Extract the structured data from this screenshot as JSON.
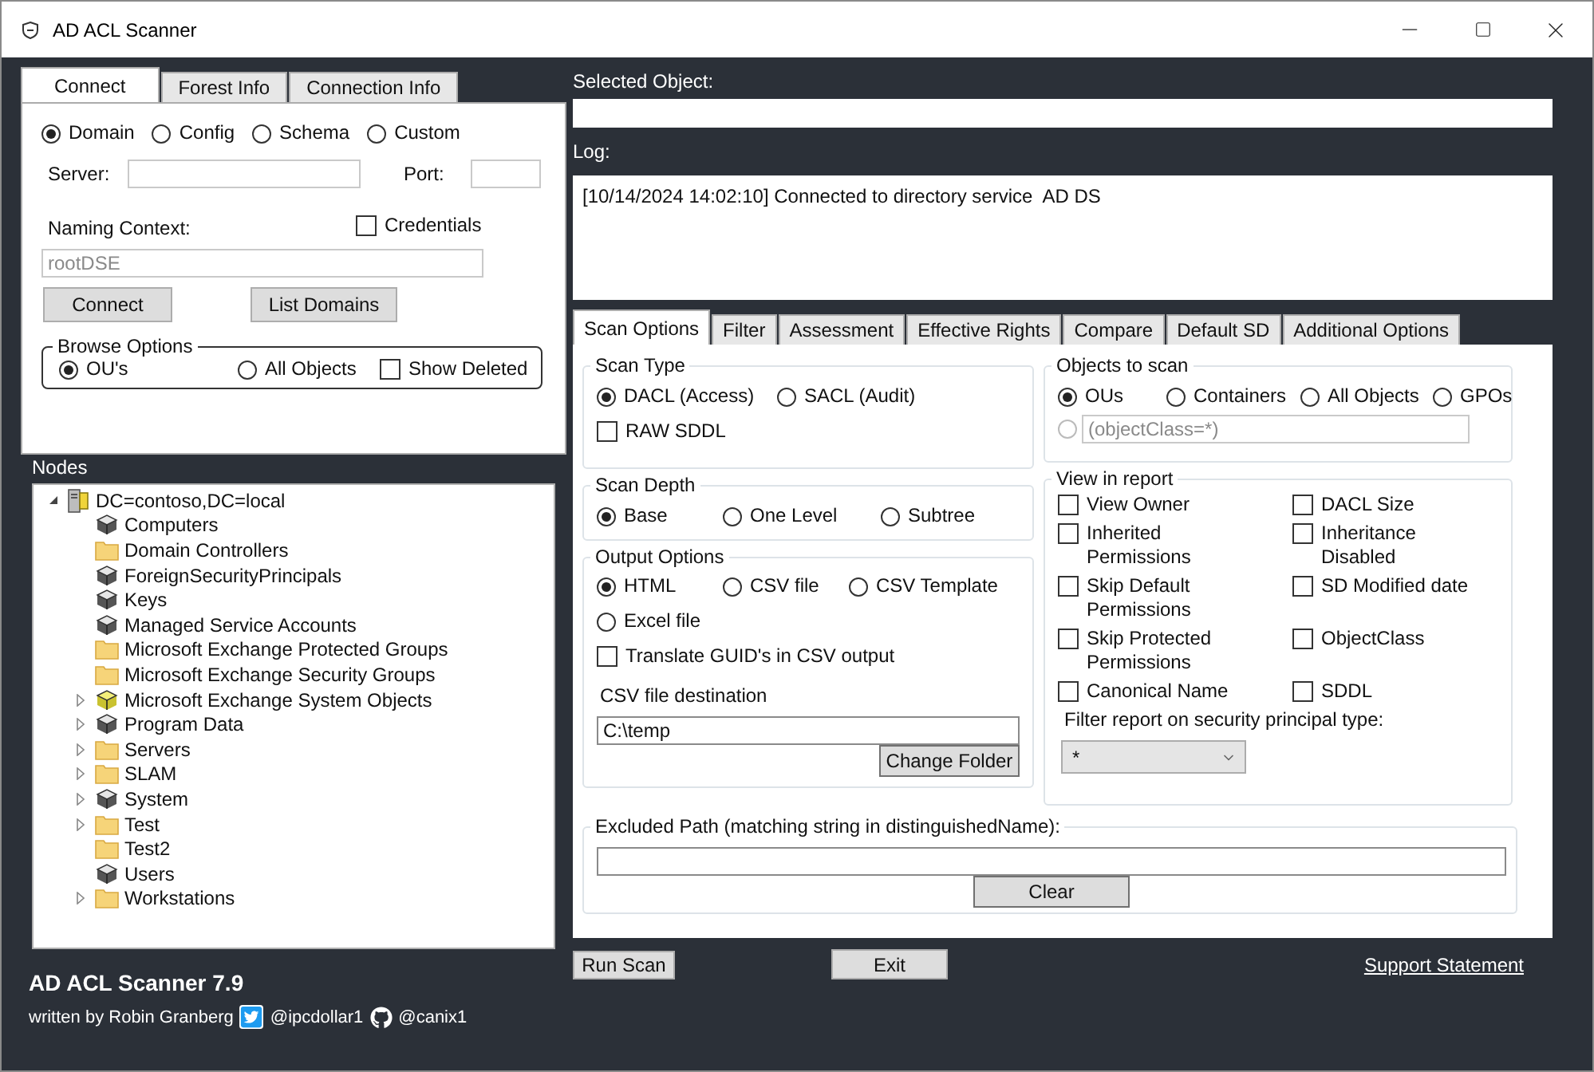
{
  "window": {
    "title": "AD ACL Scanner"
  },
  "connect_panel": {
    "tabs": [
      {
        "label": "Connect",
        "selected": true
      },
      {
        "label": "Forest Info",
        "selected": false
      },
      {
        "label": "Connection Info",
        "selected": false
      }
    ],
    "scope": [
      {
        "label": "Domain",
        "selected": true
      },
      {
        "label": "Config",
        "selected": false
      },
      {
        "label": "Schema",
        "selected": false
      },
      {
        "label": "Custom",
        "selected": false
      }
    ],
    "server_label": "Server:",
    "port_label": "Port:",
    "naming_context_label": "Naming Context:",
    "credentials": {
      "label": "Credentials",
      "checked": false
    },
    "naming_context": {
      "value": "rootDSE",
      "disabled": true
    },
    "buttons": [
      "Connect",
      "List Domains"
    ],
    "browse_options": {
      "title": "Browse Options",
      "items": [
        {
          "kind": "radio",
          "label": "OU's",
          "selected": true
        },
        {
          "kind": "radio",
          "label": "All Objects",
          "selected": false
        },
        {
          "kind": "checkbox",
          "label": "Show Deleted",
          "checked": false
        }
      ]
    }
  },
  "nodes": {
    "title": "Nodes",
    "tree": [
      {
        "label": "DC=contoso,DC=local",
        "kind": "domain",
        "has_children": true,
        "expanded": true,
        "children": [
          {
            "label": "Computers",
            "kind": "container",
            "has_children": false,
            "expanded": false
          },
          {
            "label": "Domain Controllers",
            "kind": "folder",
            "has_children": false,
            "expanded": false
          },
          {
            "label": "ForeignSecurityPrincipals",
            "kind": "container",
            "has_children": false,
            "expanded": false
          },
          {
            "label": "Keys",
            "kind": "container",
            "has_children": false,
            "expanded": false
          },
          {
            "label": "Managed Service Accounts",
            "kind": "container",
            "has_children": false,
            "expanded": false
          },
          {
            "label": "Microsoft Exchange Protected Groups",
            "kind": "folder",
            "has_children": false,
            "expanded": false
          },
          {
            "label": "Microsoft Exchange Security Groups",
            "kind": "folder",
            "has_children": false,
            "expanded": false
          },
          {
            "label": "Microsoft Exchange System Objects",
            "kind": "exchange",
            "has_children": true,
            "expanded": false
          },
          {
            "label": "Program Data",
            "kind": "container",
            "has_children": true,
            "expanded": false
          },
          {
            "label": "Servers",
            "kind": "folder",
            "has_children": true,
            "expanded": false
          },
          {
            "label": "SLAM",
            "kind": "folder",
            "has_children": true,
            "expanded": false
          },
          {
            "label": "System",
            "kind": "container",
            "has_children": true,
            "expanded": false
          },
          {
            "label": "Test",
            "kind": "folder",
            "has_children": true,
            "expanded": false
          },
          {
            "label": "Test2",
            "kind": "folder",
            "has_children": false,
            "expanded": false
          },
          {
            "label": "Users",
            "kind": "container",
            "has_children": false,
            "expanded": false
          },
          {
            "label": "Workstations",
            "kind": "folder",
            "has_children": true,
            "expanded": false
          }
        ]
      }
    ]
  },
  "footer": {
    "title": "AD ACL Scanner 7.9",
    "author": "written by Robin Granberg",
    "twitter": "@ipcdollar1",
    "github": "@canix1"
  },
  "selected_object": {
    "label": "Selected Object:"
  },
  "log": {
    "label": "Log:",
    "lines": [
      "[10/14/2024 14:02:10] Connected to directory service  AD DS"
    ]
  },
  "scan_tabs": [
    {
      "label": "Scan Options",
      "selected": true
    },
    {
      "label": "Filter",
      "selected": false
    },
    {
      "label": "Assessment",
      "selected": false
    },
    {
      "label": "Effective Rights",
      "selected": false
    },
    {
      "label": "Compare",
      "selected": false
    },
    {
      "label": "Default SD",
      "selected": false
    },
    {
      "label": "Additional Options",
      "selected": false
    }
  ],
  "scan_type": {
    "title": "Scan Type",
    "items": [
      {
        "kind": "radio",
        "label": "DACL (Access)",
        "selected": true
      },
      {
        "kind": "radio",
        "label": "SACL (Audit)",
        "selected": false
      },
      {
        "kind": "checkbox",
        "label": "RAW SDDL",
        "checked": false
      }
    ]
  },
  "scan_depth": {
    "title": "Scan Depth",
    "items": [
      {
        "kind": "radio",
        "label": "Base",
        "selected": true
      },
      {
        "kind": "radio",
        "label": "One Level",
        "selected": false
      },
      {
        "kind": "radio",
        "label": "Subtree",
        "selected": false
      }
    ]
  },
  "output_options": {
    "title": "Output Options",
    "items": [
      {
        "kind": "radio",
        "label": "HTML",
        "selected": true
      },
      {
        "kind": "radio",
        "label": "CSV file",
        "selected": false
      },
      {
        "kind": "radio",
        "label": "CSV Template",
        "selected": false
      },
      {
        "kind": "radio",
        "label": "Excel file",
        "selected": false
      },
      {
        "kind": "checkbox",
        "label": "Translate GUID's in CSV output",
        "checked": false
      }
    ],
    "destination_label": "CSV file destination",
    "destination_value": "C:\\temp",
    "change_folder_button": "Change Folder"
  },
  "objects_to_scan": {
    "title": "Objects to scan",
    "items": [
      {
        "kind": "radio",
        "label": "OUs",
        "selected": true
      },
      {
        "kind": "radio",
        "label": "Containers",
        "selected": false
      },
      {
        "kind": "radio",
        "label": "All Objects",
        "selected": false
      },
      {
        "kind": "radio",
        "label": "GPOs",
        "selected": false
      }
    ],
    "custom_filter": {
      "selected": false,
      "value": "(objectClass=*)",
      "disabled": true
    }
  },
  "view_in_report": {
    "title": "View in report",
    "items": [
      {
        "kind": "checkbox",
        "label": "View Owner",
        "checked": false
      },
      {
        "kind": "checkbox",
        "label": "DACL Size",
        "checked": false
      },
      {
        "kind": "checkbox",
        "label": "Inherited Permissions",
        "checked": false
      },
      {
        "kind": "checkbox",
        "label": "Inheritance Disabled",
        "checked": false
      },
      {
        "kind": "checkbox",
        "label": "Skip Default Permissions",
        "checked": false
      },
      {
        "kind": "checkbox",
        "label": "SD Modified date",
        "checked": false
      },
      {
        "kind": "checkbox",
        "label": "Skip Protected Permissions",
        "checked": false
      },
      {
        "kind": "checkbox",
        "label": "ObjectClass",
        "checked": false
      },
      {
        "kind": "checkbox",
        "label": "Canonical Name",
        "checked": false
      },
      {
        "kind": "checkbox",
        "label": "SDDL",
        "checked": false
      }
    ],
    "filter_label": "Filter report on security principal type:",
    "filter_value": "*"
  },
  "excluded_path": {
    "title": "Excluded Path (matching string in distinguishedName):",
    "clear_button": "Clear"
  },
  "actions": {
    "run_scan": "Run Scan",
    "exit": "Exit",
    "support_link": "Support Statement"
  }
}
